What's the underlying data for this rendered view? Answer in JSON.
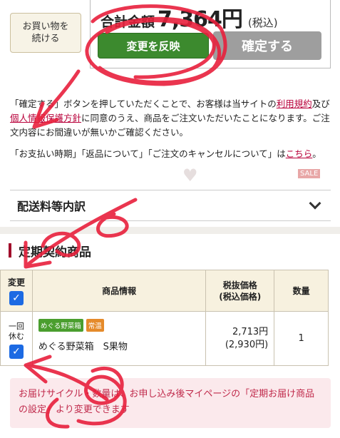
{
  "topbar": {
    "continue_label": "お買い物を\n続ける",
    "total_label": "合計金額",
    "total_amount": "7,364円",
    "total_tax": "(税込)",
    "reflect_label": "変更を反映",
    "confirm_label": "確定する"
  },
  "notice": {
    "line1_pre": "「確定する」ボタンを押していただくことで、お客様は当サイトの",
    "terms_link": "利用規約",
    "line1_mid": "及び",
    "privacy_link": "個人情報保護方針",
    "line1_post": "に同意のうえ、商品をご注文いただいたことになります。ご注文内容にお間違いが無いかご確認ください。",
    "line2_pre": "「お支払い時期」「返品について」「ご注文のキャンセルについて」は",
    "here_link": "こちら",
    "line2_post": "。"
  },
  "ghost": {
    "sale": "SALE"
  },
  "shipping": {
    "title": "配送料等内訳"
  },
  "subscription": {
    "title": "定期契約商品",
    "headers": {
      "change": "変更",
      "info": "商品情報",
      "price": "税抜価格\n(税込価格)",
      "qty": "数量"
    },
    "row": {
      "rest_label": "一回\n休む",
      "tag1": "めぐる野菜箱",
      "tag2": "常温",
      "name": "めぐる野菜箱　S果物",
      "price": "2,713円",
      "price_tax": "(2,930円)",
      "qty": "1"
    }
  },
  "info_box": {
    "text": "お届けサイクル・数量は、お申し込み後マイページの「定期お届け商品の設定」より変更できます"
  },
  "colors": {
    "reflect_button": "#3c8a2e",
    "confirm_button": "#9e9e9e",
    "accent": "#a10d2b",
    "link": "#b8003a",
    "checkbox": "#1c6ae3",
    "scribble": "#e8203c"
  },
  "icons": {
    "chevron": "chevron-down-icon",
    "check": "checkmark-icon",
    "heart": "heart-icon"
  }
}
